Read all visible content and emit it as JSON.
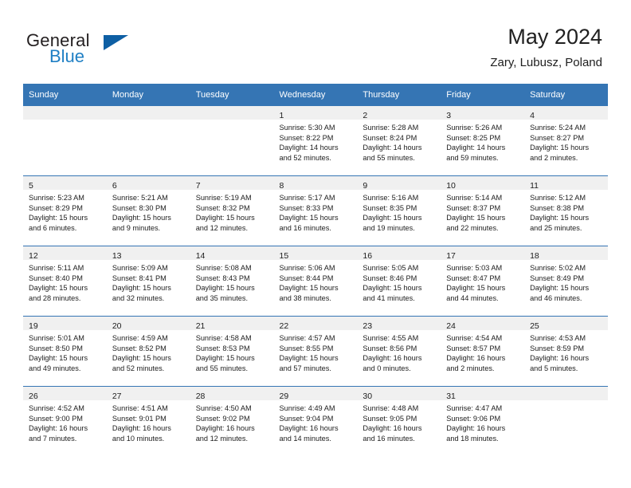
{
  "brand": {
    "word1": "General",
    "word2": "Blue",
    "logo_icon": "triangle-logo-icon",
    "color_dark": "#231f20",
    "color_blue": "#1f7fc4",
    "color_triangle": "#0e5fa4"
  },
  "header": {
    "title": "May 2024",
    "subtitle": "Zary, Lubusz, Poland"
  },
  "theme": {
    "header_bg": "#3575b4",
    "daynum_bg": "#f0f0f0",
    "text": "#202020"
  },
  "weekdays": [
    "Sunday",
    "Monday",
    "Tuesday",
    "Wednesday",
    "Thursday",
    "Friday",
    "Saturday"
  ],
  "weeks": [
    [
      {
        "day": "",
        "lines": []
      },
      {
        "day": "",
        "lines": []
      },
      {
        "day": "",
        "lines": []
      },
      {
        "day": "1",
        "lines": [
          "Sunrise: 5:30 AM",
          "Sunset: 8:22 PM",
          "Daylight: 14 hours",
          "and 52 minutes."
        ]
      },
      {
        "day": "2",
        "lines": [
          "Sunrise: 5:28 AM",
          "Sunset: 8:24 PM",
          "Daylight: 14 hours",
          "and 55 minutes."
        ]
      },
      {
        "day": "3",
        "lines": [
          "Sunrise: 5:26 AM",
          "Sunset: 8:25 PM",
          "Daylight: 14 hours",
          "and 59 minutes."
        ]
      },
      {
        "day": "4",
        "lines": [
          "Sunrise: 5:24 AM",
          "Sunset: 8:27 PM",
          "Daylight: 15 hours",
          "and 2 minutes."
        ]
      }
    ],
    [
      {
        "day": "5",
        "lines": [
          "Sunrise: 5:23 AM",
          "Sunset: 8:29 PM",
          "Daylight: 15 hours",
          "and 6 minutes."
        ]
      },
      {
        "day": "6",
        "lines": [
          "Sunrise: 5:21 AM",
          "Sunset: 8:30 PM",
          "Daylight: 15 hours",
          "and 9 minutes."
        ]
      },
      {
        "day": "7",
        "lines": [
          "Sunrise: 5:19 AM",
          "Sunset: 8:32 PM",
          "Daylight: 15 hours",
          "and 12 minutes."
        ]
      },
      {
        "day": "8",
        "lines": [
          "Sunrise: 5:17 AM",
          "Sunset: 8:33 PM",
          "Daylight: 15 hours",
          "and 16 minutes."
        ]
      },
      {
        "day": "9",
        "lines": [
          "Sunrise: 5:16 AM",
          "Sunset: 8:35 PM",
          "Daylight: 15 hours",
          "and 19 minutes."
        ]
      },
      {
        "day": "10",
        "lines": [
          "Sunrise: 5:14 AM",
          "Sunset: 8:37 PM",
          "Daylight: 15 hours",
          "and 22 minutes."
        ]
      },
      {
        "day": "11",
        "lines": [
          "Sunrise: 5:12 AM",
          "Sunset: 8:38 PM",
          "Daylight: 15 hours",
          "and 25 minutes."
        ]
      }
    ],
    [
      {
        "day": "12",
        "lines": [
          "Sunrise: 5:11 AM",
          "Sunset: 8:40 PM",
          "Daylight: 15 hours",
          "and 28 minutes."
        ]
      },
      {
        "day": "13",
        "lines": [
          "Sunrise: 5:09 AM",
          "Sunset: 8:41 PM",
          "Daylight: 15 hours",
          "and 32 minutes."
        ]
      },
      {
        "day": "14",
        "lines": [
          "Sunrise: 5:08 AM",
          "Sunset: 8:43 PM",
          "Daylight: 15 hours",
          "and 35 minutes."
        ]
      },
      {
        "day": "15",
        "lines": [
          "Sunrise: 5:06 AM",
          "Sunset: 8:44 PM",
          "Daylight: 15 hours",
          "and 38 minutes."
        ]
      },
      {
        "day": "16",
        "lines": [
          "Sunrise: 5:05 AM",
          "Sunset: 8:46 PM",
          "Daylight: 15 hours",
          "and 41 minutes."
        ]
      },
      {
        "day": "17",
        "lines": [
          "Sunrise: 5:03 AM",
          "Sunset: 8:47 PM",
          "Daylight: 15 hours",
          "and 44 minutes."
        ]
      },
      {
        "day": "18",
        "lines": [
          "Sunrise: 5:02 AM",
          "Sunset: 8:49 PM",
          "Daylight: 15 hours",
          "and 46 minutes."
        ]
      }
    ],
    [
      {
        "day": "19",
        "lines": [
          "Sunrise: 5:01 AM",
          "Sunset: 8:50 PM",
          "Daylight: 15 hours",
          "and 49 minutes."
        ]
      },
      {
        "day": "20",
        "lines": [
          "Sunrise: 4:59 AM",
          "Sunset: 8:52 PM",
          "Daylight: 15 hours",
          "and 52 minutes."
        ]
      },
      {
        "day": "21",
        "lines": [
          "Sunrise: 4:58 AM",
          "Sunset: 8:53 PM",
          "Daylight: 15 hours",
          "and 55 minutes."
        ]
      },
      {
        "day": "22",
        "lines": [
          "Sunrise: 4:57 AM",
          "Sunset: 8:55 PM",
          "Daylight: 15 hours",
          "and 57 minutes."
        ]
      },
      {
        "day": "23",
        "lines": [
          "Sunrise: 4:55 AM",
          "Sunset: 8:56 PM",
          "Daylight: 16 hours",
          "and 0 minutes."
        ]
      },
      {
        "day": "24",
        "lines": [
          "Sunrise: 4:54 AM",
          "Sunset: 8:57 PM",
          "Daylight: 16 hours",
          "and 2 minutes."
        ]
      },
      {
        "day": "25",
        "lines": [
          "Sunrise: 4:53 AM",
          "Sunset: 8:59 PM",
          "Daylight: 16 hours",
          "and 5 minutes."
        ]
      }
    ],
    [
      {
        "day": "26",
        "lines": [
          "Sunrise: 4:52 AM",
          "Sunset: 9:00 PM",
          "Daylight: 16 hours",
          "and 7 minutes."
        ]
      },
      {
        "day": "27",
        "lines": [
          "Sunrise: 4:51 AM",
          "Sunset: 9:01 PM",
          "Daylight: 16 hours",
          "and 10 minutes."
        ]
      },
      {
        "day": "28",
        "lines": [
          "Sunrise: 4:50 AM",
          "Sunset: 9:02 PM",
          "Daylight: 16 hours",
          "and 12 minutes."
        ]
      },
      {
        "day": "29",
        "lines": [
          "Sunrise: 4:49 AM",
          "Sunset: 9:04 PM",
          "Daylight: 16 hours",
          "and 14 minutes."
        ]
      },
      {
        "day": "30",
        "lines": [
          "Sunrise: 4:48 AM",
          "Sunset: 9:05 PM",
          "Daylight: 16 hours",
          "and 16 minutes."
        ]
      },
      {
        "day": "31",
        "lines": [
          "Sunrise: 4:47 AM",
          "Sunset: 9:06 PM",
          "Daylight: 16 hours",
          "and 18 minutes."
        ]
      },
      {
        "day": "",
        "lines": []
      }
    ]
  ]
}
